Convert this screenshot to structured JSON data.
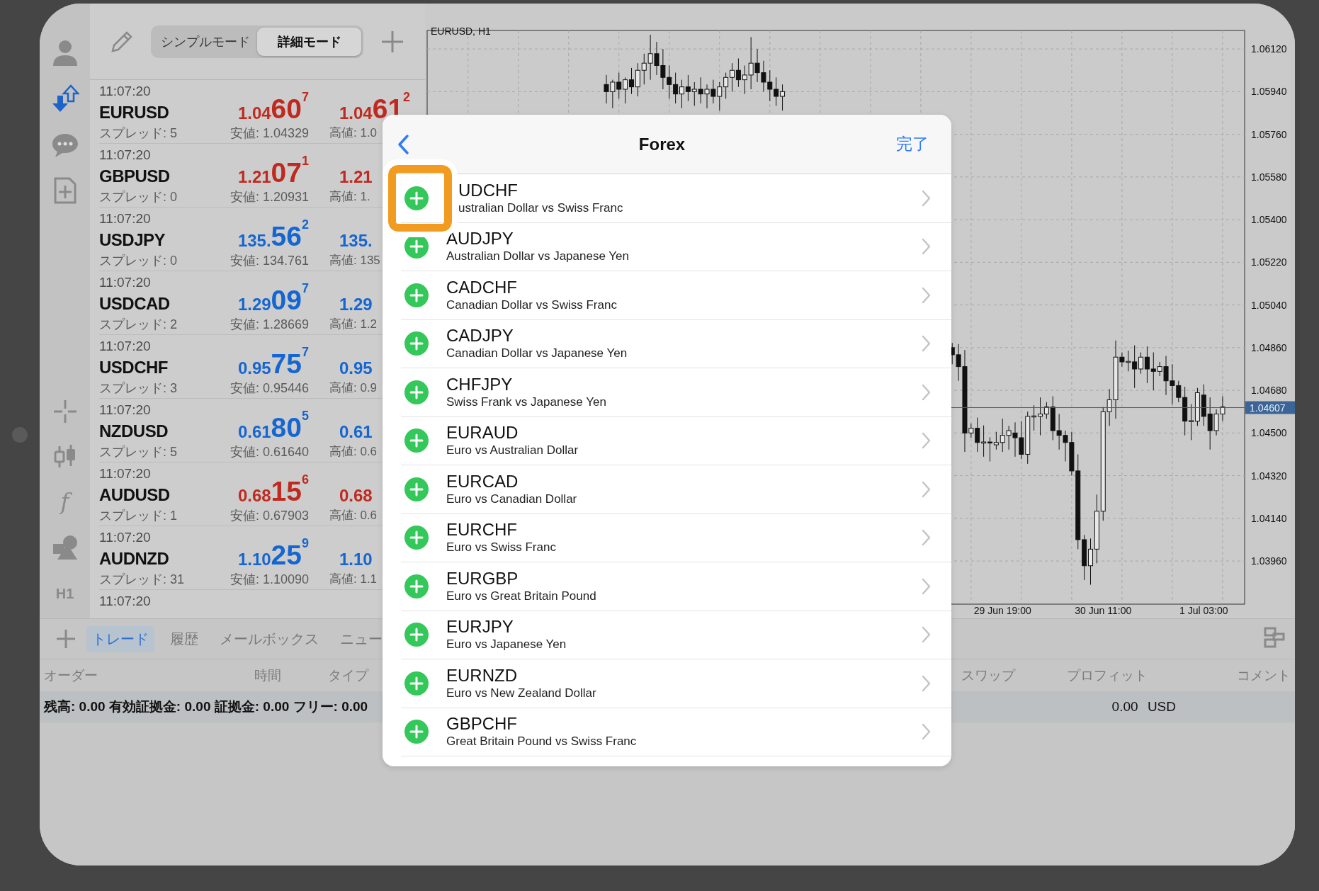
{
  "side_toolbar": {
    "function_label": "f",
    "timeframe": "H1"
  },
  "mode_tabs": [
    {
      "label": "シンプルモード",
      "selected": false
    },
    {
      "label": "詳細モード",
      "selected": true
    }
  ],
  "quotes": [
    {
      "time": "11:07:20",
      "symbol": "EURUSD",
      "spread": "スプレッド: 5",
      "color": "#bf2a20",
      "bid": {
        "lead": "1.04",
        "big": "60",
        "small": "7"
      },
      "low": "安値: 1.04329",
      "ask": {
        "lead": "1.04",
        "big": "61",
        "small": "2"
      },
      "high": "高値: 1.0"
    },
    {
      "time": "11:07:20",
      "symbol": "GBPUSD",
      "spread": "スプレッド: 0",
      "color": "#bf2a20",
      "bid": {
        "lead": "1.21",
        "big": "07",
        "small": "1"
      },
      "low": "安値: 1.20931",
      "ask": {
        "lead": "1.21"
      },
      "high": "高値: 1."
    },
    {
      "time": "11:07:20",
      "symbol": "USDJPY",
      "spread": "スプレッド: 0",
      "color": "#1566d0",
      "bid": {
        "lead": "135.",
        "big": "56",
        "small": "2"
      },
      "low": "安値: 134.761",
      "ask": {
        "lead": "135."
      },
      "high": "高値: 135"
    },
    {
      "time": "11:07:20",
      "symbol": "USDCAD",
      "spread": "スプレッド: 2",
      "color": "#1566d0",
      "bid": {
        "lead": "1.29",
        "big": "09",
        "small": "7"
      },
      "low": "安値: 1.28669",
      "ask": {
        "lead": "1.29"
      },
      "high": "高値: 1.2"
    },
    {
      "time": "11:07:20",
      "symbol": "USDCHF",
      "spread": "スプレッド: 3",
      "color": "#1566d0",
      "bid": {
        "lead": "0.95",
        "big": "75",
        "small": "7"
      },
      "low": "安値: 0.95446",
      "ask": {
        "lead": "0.95"
      },
      "high": "高値: 0.9"
    },
    {
      "time": "11:07:20",
      "symbol": "NZDUSD",
      "spread": "スプレッド: 5",
      "color": "#1566d0",
      "bid": {
        "lead": "0.61",
        "big": "80",
        "small": "5"
      },
      "low": "安値: 0.61640",
      "ask": {
        "lead": "0.61"
      },
      "high": "高値: 0.6"
    },
    {
      "time": "11:07:20",
      "symbol": "AUDUSD",
      "spread": "スプレッド: 1",
      "color": "#bf2a20",
      "bid": {
        "lead": "0.68",
        "big": "15",
        "small": "6"
      },
      "low": "安値: 0.67903",
      "ask": {
        "lead": "0.68"
      },
      "high": "高値: 0.6"
    },
    {
      "time": "11:07:20",
      "symbol": "AUDNZD",
      "spread": "スプレッド: 31",
      "color": "#1566d0",
      "bid": {
        "lead": "1.10",
        "big": "25",
        "small": "9"
      },
      "low": "安値: 1.10090",
      "ask": {
        "lead": "1.10"
      },
      "high": "高値: 1.1"
    },
    {
      "time": "11:07:20"
    }
  ],
  "chart": {
    "chart_data": {
      "type": "candlestick",
      "title": "EURUSD, H1",
      "ylim": [
        1.03778,
        1.06198
      ],
      "yticks": [
        {
          "value": 1.0612,
          "label": "1.06120"
        },
        {
          "value": 1.0594,
          "label": "1.05940"
        },
        {
          "value": 1.0576,
          "label": "1.05760"
        },
        {
          "value": 1.0558,
          "label": "1.05580"
        },
        {
          "value": 1.054,
          "label": "1.05400"
        },
        {
          "value": 1.0522,
          "label": "1.05220"
        },
        {
          "value": 1.0504,
          "label": "1.05040"
        },
        {
          "value": 1.0486,
          "label": "1.04860"
        },
        {
          "value": 1.0468,
          "label": "1.04680"
        },
        {
          "value": 1.045,
          "label": "1.04500"
        },
        {
          "value": 1.0432,
          "label": "1.04320"
        },
        {
          "value": 1.0414,
          "label": "1.04140"
        },
        {
          "value": 1.0396,
          "label": "1.03960"
        }
      ],
      "grid": true,
      "ref_lines": [
        {
          "axis": "y",
          "value": 1.04607,
          "label": "1.04607"
        }
      ],
      "categories": [
        null,
        null,
        null,
        null,
        null,
        null,
        null,
        null,
        null,
        null,
        null,
        null,
        null,
        null,
        null,
        null,
        null,
        null,
        null,
        null,
        null,
        null,
        null,
        null,
        null,
        null,
        null,
        null,
        null,
        null,
        null,
        null,
        null,
        null,
        null,
        null,
        null,
        null,
        null,
        null,
        null,
        null,
        null,
        null,
        null,
        null,
        null,
        null,
        null,
        null,
        null,
        null,
        null,
        null,
        null,
        null,
        null,
        null,
        null,
        null,
        null,
        null,
        null,
        null,
        null,
        null,
        null,
        null,
        null,
        null,
        null,
        null,
        null,
        null,
        null,
        null,
        null,
        null,
        null,
        null,
        null,
        null,
        null,
        null,
        null,
        null,
        null,
        null,
        null,
        null,
        null,
        "29 Jun 19:00",
        null,
        null,
        null,
        null,
        null,
        null,
        null,
        null,
        null,
        null,
        null,
        null,
        null,
        null,
        null,
        "30 Jun 11:00",
        null,
        null,
        null,
        null,
        null,
        null,
        null,
        null,
        null,
        null,
        null,
        null,
        null,
        null,
        null,
        "1 Jul 03:00",
        null,
        null,
        null,
        null,
        null,
        null
      ],
      "ohlc": [
        null,
        null,
        null,
        null,
        null,
        null,
        null,
        null,
        null,
        null,
        null,
        null,
        null,
        null,
        null,
        null,
        null,
        null,
        null,
        null,
        null,
        null,
        null,
        null,
        null,
        null,
        null,
        null,
        [
          1.0597,
          1.0601,
          1.0589,
          1.0594
        ],
        [
          1.0594,
          1.0599,
          1.0587,
          1.0598
        ],
        [
          1.0598,
          1.0602,
          1.0591,
          1.0595
        ],
        [
          1.0595,
          1.06,
          1.0589,
          1.0599
        ],
        [
          1.0599,
          1.0604,
          1.0593,
          1.0596
        ],
        [
          1.0596,
          1.0606,
          1.0592,
          1.0603
        ],
        [
          1.0603,
          1.061,
          1.0597,
          1.0606
        ],
        [
          1.0606,
          1.0618,
          1.0599,
          1.061
        ],
        [
          1.061,
          1.0615,
          1.0601,
          1.0605
        ],
        [
          1.0605,
          1.0612,
          1.0595,
          1.06
        ],
        [
          1.06,
          1.0605,
          1.0591,
          1.0597
        ],
        [
          1.0597,
          1.0602,
          1.0589,
          1.0593
        ],
        [
          1.0593,
          1.0599,
          1.0587,
          1.0596
        ],
        [
          1.0596,
          1.0601,
          1.059,
          1.0594
        ],
        [
          1.0594,
          1.0598,
          1.0588,
          1.0595
        ],
        [
          1.0595,
          1.06,
          1.0589,
          1.0593
        ],
        [
          1.0593,
          1.0597,
          1.0587,
          1.0595
        ],
        [
          1.0595,
          1.0599,
          1.0589,
          1.0592
        ],
        [
          1.0592,
          1.0598,
          1.0586,
          1.0596
        ],
        [
          1.0596,
          1.0602,
          1.0591,
          1.06
        ],
        [
          1.06,
          1.0606,
          1.0594,
          1.0603
        ],
        [
          1.0603,
          1.0608,
          1.0596,
          1.0599
        ],
        [
          1.0599,
          1.0605,
          1.0593,
          1.0601
        ],
        [
          1.0601,
          1.0617,
          1.0595,
          1.0606
        ],
        [
          1.0606,
          1.0612,
          1.0598,
          1.0602
        ],
        [
          1.0602,
          1.0607,
          1.0594,
          1.0598
        ],
        [
          1.0598,
          1.0603,
          1.059,
          1.0595
        ],
        [
          1.0595,
          1.06,
          1.0588,
          1.0592
        ],
        [
          1.0592,
          1.0597,
          1.0586,
          1.0594
        ],
        null,
        null,
        null,
        null,
        null,
        null,
        null,
        null,
        null,
        null,
        null,
        null,
        null,
        null,
        null,
        null,
        null,
        null,
        null,
        null,
        null,
        null,
        null,
        null,
        null,
        null,
        [
          1.0486,
          1.0488,
          1.0479,
          1.0483
        ],
        [
          1.0483,
          1.04875,
          1.0472,
          1.0478
        ],
        [
          1.0478,
          1.0485,
          1.0442,
          1.045
        ],
        [
          1.045,
          1.0454,
          1.0448,
          1.0452
        ],
        [
          1.0452,
          1.04565,
          1.0442,
          1.0446
        ],
        [
          1.0446,
          1.04532,
          1.044,
          1.04462
        ],
        [
          1.04462,
          1.04482,
          1.0438,
          1.0446
        ],
        [
          1.0445,
          1.04505,
          1.0443,
          1.0446
        ],
        [
          1.0446,
          1.0456,
          1.0442,
          1.0449
        ],
        [
          1.0449,
          1.0453,
          1.0443,
          1.0451
        ],
        [
          1.045,
          1.04545,
          1.044,
          1.0448
        ],
        [
          1.0448,
          1.0455,
          1.0439,
          1.0441
        ],
        [
          1.0441,
          1.0459,
          1.0437,
          1.0457
        ],
        [
          1.0457,
          1.04617,
          1.0451,
          1.04572
        ],
        [
          1.0457,
          1.0465,
          1.0449,
          1.0458
        ],
        [
          1.0458,
          1.0463,
          1.0456,
          1.0461
        ],
        [
          1.0461,
          1.04655,
          1.0447,
          1.0451
        ],
        [
          1.0451,
          1.0458,
          1.0443,
          1.0449
        ],
        [
          1.0449,
          1.0451,
          1.0438,
          1.0446
        ],
        [
          1.0446,
          1.04505,
          1.0432,
          1.0434
        ],
        [
          1.0434,
          1.0441,
          1.0401,
          1.0405
        ],
        [
          1.0405,
          1.0407,
          1.0388,
          1.0394
        ],
        [
          1.0394,
          1.04055,
          1.0386,
          1.0401
        ],
        [
          1.0401,
          1.0424,
          1.0395,
          1.0417
        ],
        [
          1.0417,
          1.0461,
          1.0413,
          1.0459
        ],
        [
          1.0459,
          1.04685,
          1.0453,
          1.0464
        ],
        [
          1.0464,
          1.0489,
          1.0456,
          1.0482
        ],
        [
          1.0482,
          1.0484,
          1.0478,
          1.048
        ],
        [
          1.048,
          1.04847,
          1.0476,
          1.04802
        ],
        [
          1.048,
          1.0487,
          1.0469,
          1.0477
        ],
        [
          1.0477,
          1.0484,
          1.0475,
          1.0482
        ],
        [
          1.0482,
          1.04865,
          1.0471,
          1.0477
        ],
        [
          1.0477,
          1.0484,
          1.0468,
          1.0476
        ],
        [
          1.0476,
          1.048,
          1.0474,
          1.0478
        ],
        [
          1.0478,
          1.04825,
          1.0466,
          1.0472
        ],
        [
          1.0472,
          1.0479,
          1.0462,
          1.047
        ],
        [
          1.047,
          1.0472,
          1.0463,
          1.0465
        ],
        [
          1.0465,
          1.04695,
          1.0449,
          1.0455
        ],
        [
          1.0455,
          1.04622,
          1.0447,
          1.04552
        ],
        [
          1.0455,
          1.0469,
          1.0453,
          1.0467
        ],
        [
          1.0466,
          1.04705,
          1.0453,
          1.0457
        ],
        [
          1.0458,
          1.0465,
          1.0443,
          1.0451
        ],
        [
          1.0451,
          1.046,
          1.0449,
          1.0458
        ],
        [
          1.0458,
          1.04655,
          1.0455,
          1.0461
        ],
        null,
        null,
        null
      ]
    }
  },
  "bottom_tabs": [
    {
      "label": "トレード",
      "selected": true
    },
    {
      "label": "履歴",
      "selected": false
    },
    {
      "label": "メールボックス",
      "selected": false
    },
    {
      "label": "ニュー",
      "selected": false
    }
  ],
  "columns": [
    "オーダー",
    "時間",
    "タイプ",
    "スワップ",
    "プロフィット",
    "コメント"
  ],
  "balance": {
    "summary": "残高: 0.00 有効証拠金: 0.00 証拠金: 0.00 フリー: 0.00",
    "profit": "0.00",
    "currency": "USD"
  },
  "modal": {
    "title": "Forex",
    "done": "完了",
    "items": [
      {
        "symbol": "UDCHF",
        "description": "ustralian Dollar vs Swiss Franc",
        "highlighted": true
      },
      {
        "symbol": "AUDJPY",
        "description": "Australian Dollar vs Japanese Yen",
        "highlighted": false
      },
      {
        "symbol": "CADCHF",
        "description": "Canadian Dollar vs Swiss Franc",
        "highlighted": false
      },
      {
        "symbol": "CADJPY",
        "description": "Canadian Dollar vs Japanese Yen",
        "highlighted": false
      },
      {
        "symbol": "CHFJPY",
        "description": "Swiss Frank vs Japanese Yen",
        "highlighted": false
      },
      {
        "symbol": "EURAUD",
        "description": "Euro vs Australian Dollar",
        "highlighted": false
      },
      {
        "symbol": "EURCAD",
        "description": "Euro vs Canadian Dollar",
        "highlighted": false
      },
      {
        "symbol": "EURCHF",
        "description": "Euro vs Swiss Franc",
        "highlighted": false
      },
      {
        "symbol": "EURGBP",
        "description": "Euro vs Great Britain Pound",
        "highlighted": false
      },
      {
        "symbol": "EURJPY",
        "description": "Euro vs Japanese Yen",
        "highlighted": false
      },
      {
        "symbol": "EURNZD",
        "description": "Euro vs New Zealand Dollar",
        "highlighted": false
      },
      {
        "symbol": "GBPCHF",
        "description": "Great Britain Pound vs Swiss Franc",
        "highlighted": false
      }
    ]
  }
}
